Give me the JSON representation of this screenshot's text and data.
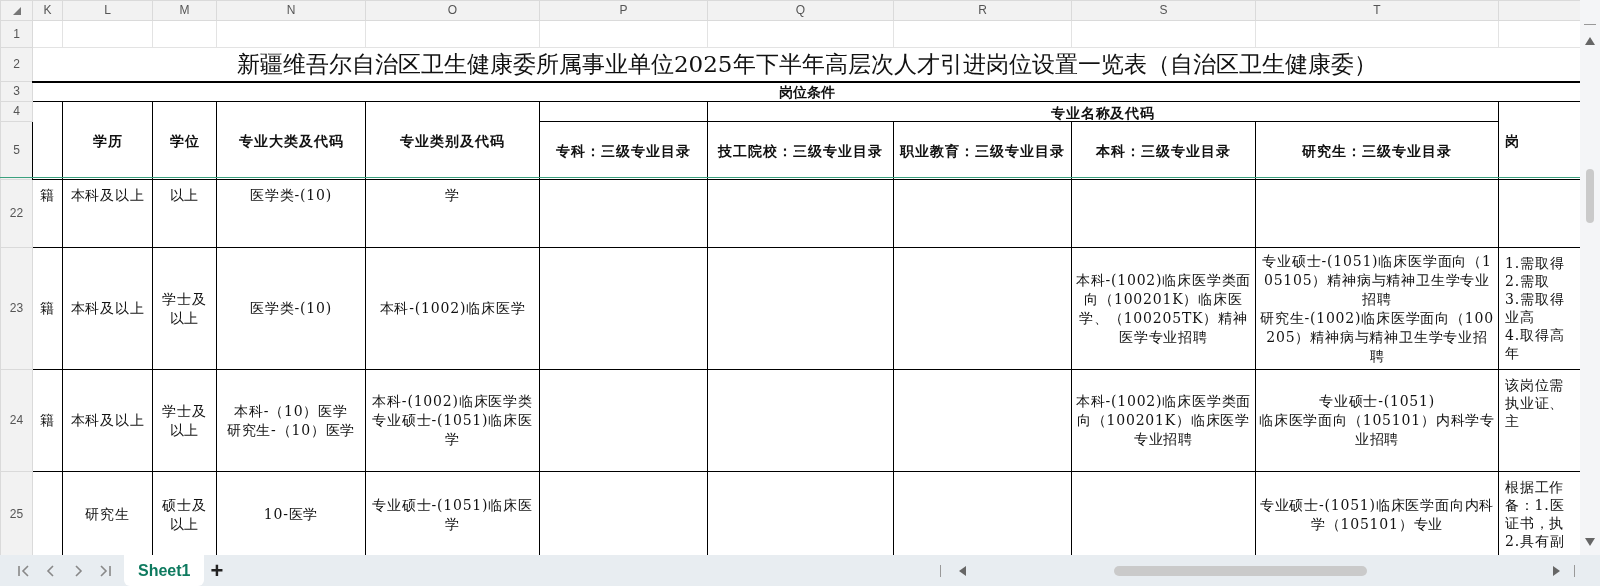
{
  "column_headers": [
    "K",
    "L",
    "M",
    "N",
    "O",
    "P",
    "Q",
    "R",
    "S",
    "T"
  ],
  "row_headers": [
    "1",
    "2",
    "3",
    "4",
    "5"
  ],
  "title": "新疆维吾尔自治区卫生健康委所属事业单位2025年下半年高层次人才引进岗位设置一览表（自治区卫生健康委）",
  "group_header": "岗位条件",
  "subgroup_header": "专业名称及代码",
  "header_cells": [
    null,
    "学历",
    "学位",
    "专业大类及代码",
    "专业类别及代码",
    "专科：三级专业目录",
    "技工院校：三级专业目录",
    "职业教育：三级专业目录",
    "本科：三级专业目录",
    "研究生：三级专业目录",
    "岗"
  ],
  "rows": [
    {
      "number": "22",
      "cells": [
        "籍",
        "本科及以上",
        "以上",
        "医学类-(10)",
        "学",
        null,
        null,
        null,
        null,
        null,
        null
      ]
    },
    {
      "number": "23",
      "cells": [
        "籍",
        "本科及以上",
        "学士及以上",
        "医学类-(10)",
        "本科-(1002)临床医学",
        null,
        null,
        null,
        "本科-(1002)临床医学类面向（100201K）临床医学、（100205TK）精神医学专业招聘",
        [
          "专业硕士-(1051)临床医学面向（105105）精神病与精神卫生学专业招聘",
          "研究生-(1002)临床医学面向（100205）精神病与精神卫生学专业招聘"
        ],
        [
          "1.需取得",
          "2.需取",
          "3.需取得",
          "业高",
          "4.取得高",
          "年"
        ]
      ]
    },
    {
      "number": "24",
      "cells": [
        "籍",
        "本科及以上",
        "学士及以上",
        [
          "本科-（10）医学",
          "研究生-（10）医学"
        ],
        [
          "本科-(1002)临床医学类",
          "专业硕士-(1051)临床医学"
        ],
        null,
        null,
        null,
        "本科-(1002)临床医学类面向（100201K）临床医学专业招聘",
        [
          "专业硕士-(1051)",
          "临床医学面向（105101）内科学专业招聘"
        ],
        [
          "该岗位需",
          "执业证、",
          "主"
        ]
      ]
    },
    {
      "number": "25",
      "cells": [
        null,
        "研究生",
        "硕士及以上",
        "10-医学",
        "专业硕士-(1051)临床医学",
        null,
        null,
        null,
        null,
        "专业硕士-(1051)临床医学面向内科学（105101）专业",
        [
          "根据工作",
          "备：1.医",
          "证书，执",
          "2.具有副"
        ]
      ]
    }
  ],
  "sheets": [
    {
      "label": "Sheet1",
      "selected": true
    }
  ],
  "add_sheet": "+"
}
